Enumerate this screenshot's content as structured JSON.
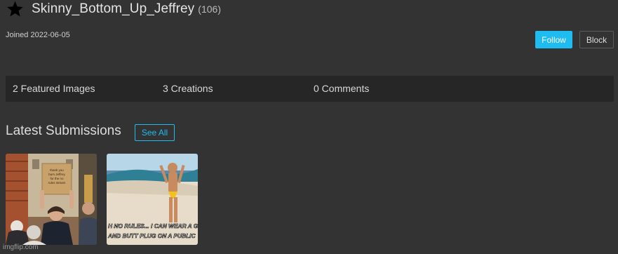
{
  "profile": {
    "username": "Skinny_Bottom_Up_Jeffrey",
    "points": "(106)",
    "joined": "Joined 2022-06-05",
    "follow_label": "Follow",
    "block_label": "Block"
  },
  "stats": {
    "featured": "2 Featured Images",
    "creations": "3 Creations",
    "comments": "0 Comments"
  },
  "submissions": {
    "title": "Latest Submissions",
    "see_all_label": "See All",
    "items": [
      {
        "sign_text": [
          "thank you",
          "bum Jeffrey",
          "for the no",
          "rules stream"
        ]
      },
      {
        "caption": [
          "H NO RULES... I CAN WEAR A G",
          "AND BUTT PLUG ON A PUBLIC"
        ]
      }
    ]
  },
  "watermark": "imgflip.com",
  "colors": {
    "background": "#333333",
    "stats_bar": "#262626",
    "accent": "#1ebcf0"
  },
  "icons": {
    "star": "star-icon"
  }
}
